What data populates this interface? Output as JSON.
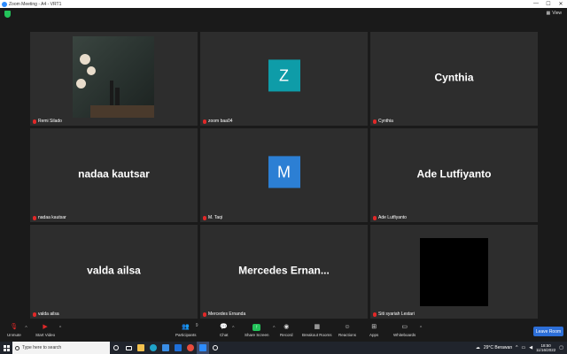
{
  "window": {
    "title": "Zoom Meeting - A4 - VRT1",
    "minimize": "—",
    "maximize": "☐",
    "close": "✕"
  },
  "topbar": {
    "view_label": "View"
  },
  "tiles": [
    {
      "label": "Remi Silado",
      "type": "photo"
    },
    {
      "label": "zoom baa04",
      "type": "avatar",
      "letter": "Z",
      "color": "#0e9ca8"
    },
    {
      "label": "Cynthia",
      "type": "name",
      "big": "Cynthia"
    },
    {
      "label": "nadaa kautsar",
      "type": "name",
      "big": "nadaa kautsar"
    },
    {
      "label": "M. Taqi",
      "type": "avatar",
      "letter": "M",
      "color": "#2c7fd4"
    },
    {
      "label": "Ade Lutfiyanto",
      "type": "name",
      "big": "Ade Lutfiyanto"
    },
    {
      "label": "valda ailsa",
      "type": "name",
      "big": "valda ailsa"
    },
    {
      "label": "Mercedes Ernanda",
      "type": "name",
      "big": "Mercedes  Ernan..."
    },
    {
      "label": "Siti syariah Lestari",
      "type": "black"
    }
  ],
  "toolbar": {
    "unmute": "Unmute",
    "start_video": "Start Video",
    "participants": "Participants",
    "participants_count": "9",
    "chat": "Chat",
    "share_screen": "Share Screen",
    "record": "Record",
    "breakout_rooms": "Breakout Rooms",
    "reactions": "Reactions",
    "apps": "Apps",
    "whiteboards": "Whiteboards",
    "leave_room": "Leave Room"
  },
  "taskbar": {
    "search_placeholder": "Type here to search",
    "weather": "29°C  Berawan",
    "time": "18:50",
    "date": "11/16/2022"
  },
  "colors": {
    "accent": "#2d8cff",
    "share_green": "#23c35a",
    "mute_red": "#e02828",
    "leave_blue": "#2d6fd8"
  }
}
